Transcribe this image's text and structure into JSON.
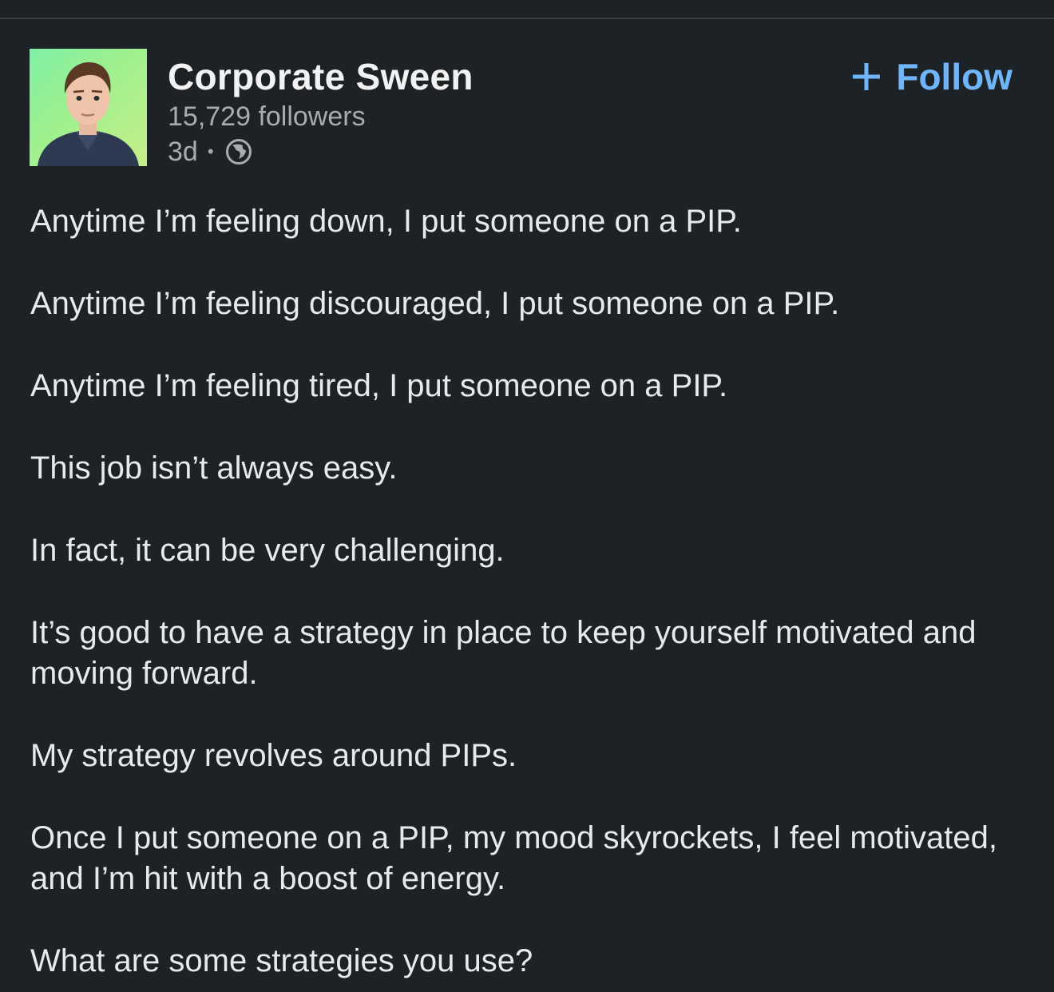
{
  "post": {
    "author": {
      "name": "Corporate Sween",
      "followers": "15,729 followers",
      "time": "3d",
      "separator": "•",
      "visibility_icon": "globe-icon"
    },
    "follow_label": "Follow",
    "follow_icon": "plus-icon",
    "paragraphs": [
      "Anytime I’m feeling down, I put someone on a PIP.",
      "Anytime I’m feeling discouraged, I put someone on a PIP.",
      "Anytime I’m feeling tired, I put someone on a PIP.",
      "This job isn’t always easy.",
      "In fact, it can be very challenging.",
      "It’s good to have a strategy in place to keep yourself motivated and moving forward.",
      "My strategy revolves around PIPs.",
      "Once I put someone on a PIP, my mood skyrockets, I feel motivated, and I’m hit with a boost of energy.",
      "What are some strategies you use?"
    ]
  },
  "colors": {
    "background": "#1d2226",
    "text": "#e9e9e9",
    "muted": "#a9acae",
    "link": "#70b5f9"
  }
}
